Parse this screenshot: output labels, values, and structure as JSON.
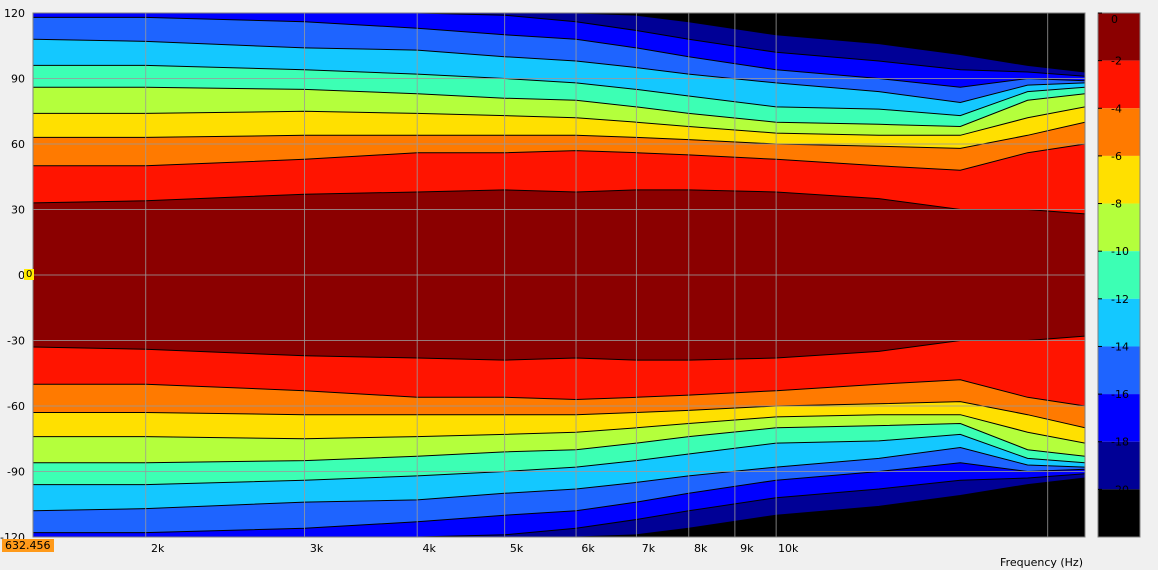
{
  "chart_data": {
    "type": "heatmap",
    "subtype": "polar-directivity-contour",
    "xlabel": "Frequency  (Hz)",
    "x_scale": "log",
    "xlim": [
      1500,
      22000
    ],
    "x_ticks": [
      {
        "value": 2000,
        "label": "2k"
      },
      {
        "value": 3000,
        "label": "3k"
      },
      {
        "value": 4000,
        "label": "4k"
      },
      {
        "value": 5000,
        "label": "5k"
      },
      {
        "value": 6000,
        "label": "6k"
      },
      {
        "value": 7000,
        "label": "7k"
      },
      {
        "value": 8000,
        "label": "8k"
      },
      {
        "value": 9000,
        "label": "9k"
      },
      {
        "value": 10000,
        "label": "10k"
      }
    ],
    "x_minor_ticks": [
      20000
    ],
    "ylim": [
      -120,
      120
    ],
    "y_ticks": [
      120,
      90,
      60,
      30,
      0,
      -30,
      -60,
      -90,
      -120
    ],
    "y_tick_labels": [
      "120",
      "90",
      "60",
      "30",
      "0",
      "-30",
      "-60",
      "-90",
      "-120"
    ],
    "grid": true,
    "legend": "right",
    "colorbar": {
      "ticks": [
        0,
        -2,
        -4,
        -6,
        -8,
        -10,
        -12,
        -14,
        -16,
        -18,
        -20
      ],
      "levels": [
        {
          "from": 0,
          "to": -2,
          "color": "#8b0000"
        },
        {
          "from": -2,
          "to": -4,
          "color": "#ff1400"
        },
        {
          "from": -4,
          "to": -6,
          "color": "#ff7a00"
        },
        {
          "from": -6,
          "to": -8,
          "color": "#ffe000"
        },
        {
          "from": -8,
          "to": -10,
          "color": "#b4ff3c"
        },
        {
          "from": -10,
          "to": -12,
          "color": "#3cffb4"
        },
        {
          "from": -12,
          "to": -14,
          "color": "#14c8ff"
        },
        {
          "from": -14,
          "to": -16,
          "color": "#1e64ff"
        },
        {
          "from": -16,
          "to": -18,
          "color": "#0000ff"
        },
        {
          "from": -18,
          "to": -20,
          "color": "#000096"
        },
        {
          "from": -20,
          "to": -22,
          "color": "#000000"
        }
      ]
    },
    "frequencies": [
      1500,
      2000,
      3000,
      4000,
      5000,
      6000,
      7000,
      8000,
      10000,
      13000,
      16000,
      19000,
      22000
    ],
    "contour_angles": [
      {
        "level": -2,
        "angle": [
          33,
          34,
          37,
          38,
          39,
          38,
          39,
          39,
          38,
          35,
          30,
          30,
          28
        ]
      },
      {
        "level": -4,
        "angle": [
          50,
          50,
          53,
          56,
          56,
          57,
          56,
          55,
          53,
          50,
          48,
          56,
          60
        ]
      },
      {
        "level": -6,
        "angle": [
          63,
          63,
          64,
          64,
          64,
          64,
          63,
          62,
          60,
          59,
          58,
          64,
          70
        ]
      },
      {
        "level": -8,
        "angle": [
          74,
          74,
          75,
          74,
          73,
          72,
          70,
          68,
          65,
          64,
          64,
          72,
          77
        ]
      },
      {
        "level": -10,
        "angle": [
          86,
          86,
          85,
          83,
          81,
          80,
          77,
          74,
          70,
          69,
          68,
          80,
          83
        ]
      },
      {
        "level": -12,
        "angle": [
          96,
          96,
          94,
          92,
          90,
          88,
          85,
          82,
          77,
          76,
          73,
          84,
          86
        ]
      },
      {
        "level": -14,
        "angle": [
          108,
          107,
          104,
          103,
          100,
          98,
          95,
          92,
          88,
          84,
          79,
          87,
          88
        ]
      },
      {
        "level": -16,
        "angle": [
          118,
          118,
          116,
          113,
          110,
          108,
          104,
          100,
          94,
          90,
          86,
          90,
          89
        ]
      },
      {
        "level": -18,
        "angle": [
          121,
          121,
          121,
          120,
          119,
          116,
          112,
          108,
          102,
          98,
          94,
          93,
          91
        ]
      },
      {
        "level": -20,
        "angle": [
          121,
          121,
          121,
          121,
          121,
          121,
          119,
          116,
          110,
          106,
          101,
          96,
          93
        ]
      }
    ],
    "symmetric_about_zero": true,
    "cursor_x_value": "632.456",
    "cursor_y_value": "0"
  }
}
